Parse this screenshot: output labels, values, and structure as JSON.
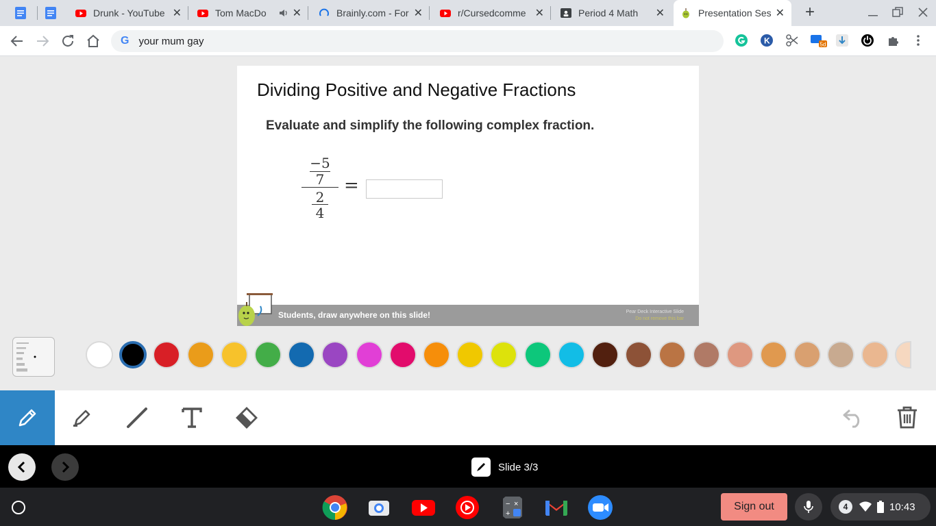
{
  "tabs": [
    {
      "title": "Drunk - YouTube",
      "icon": "youtube-icon"
    },
    {
      "title": "Tom MacDo",
      "icon": "youtube-icon",
      "audio": true
    },
    {
      "title": "Brainly.com - For",
      "icon": "brainly-icon"
    },
    {
      "title": "r/Cursedcomme",
      "icon": "youtube-icon"
    },
    {
      "title": "Period 4 Math",
      "icon": "classroom-icon"
    },
    {
      "title": "Presentation Ses",
      "icon": "peardeck-icon",
      "active": true
    }
  ],
  "omnibox": {
    "text": "your mum gay",
    "g_letter": "G"
  },
  "slide": {
    "title": "Dividing Positive and Negative Fractions",
    "instruction": "Evaluate and simplify the following complex fraction.",
    "fraction": {
      "num_top": "−5",
      "num_bottom": "7",
      "den_top": "2",
      "den_bottom": "4",
      "equals": "="
    },
    "footer": "Students, draw anywhere on this slide!",
    "brand_line1": "Pear Deck Interactive Slide",
    "brand_line2": "Do not remove this bar"
  },
  "palette": {
    "colors": [
      "#ffffff",
      "#000000",
      "#d81f26",
      "#ea9c1a",
      "#f7c22b",
      "#43ad48",
      "#136ab0",
      "#9a46c2",
      "#e13fd6",
      "#e20c6c",
      "#f68e0a",
      "#f0c800",
      "#dde20b",
      "#0dc77b",
      "#12bde6",
      "#52200f",
      "#8d5237",
      "#ba7444",
      "#b07a66",
      "#de9880",
      "#e0994f",
      "#d9a070",
      "#c8aa90",
      "#eab790",
      "#f6d8c0"
    ],
    "selected_index": 1
  },
  "tools": [
    "pencil-icon",
    "marker-icon",
    "line-icon",
    "text-icon",
    "eraser-icon"
  ],
  "slide_counter": "Slide 3/3",
  "shelf": {
    "signout": "Sign out",
    "notif_count": "4",
    "time": "10:43"
  }
}
